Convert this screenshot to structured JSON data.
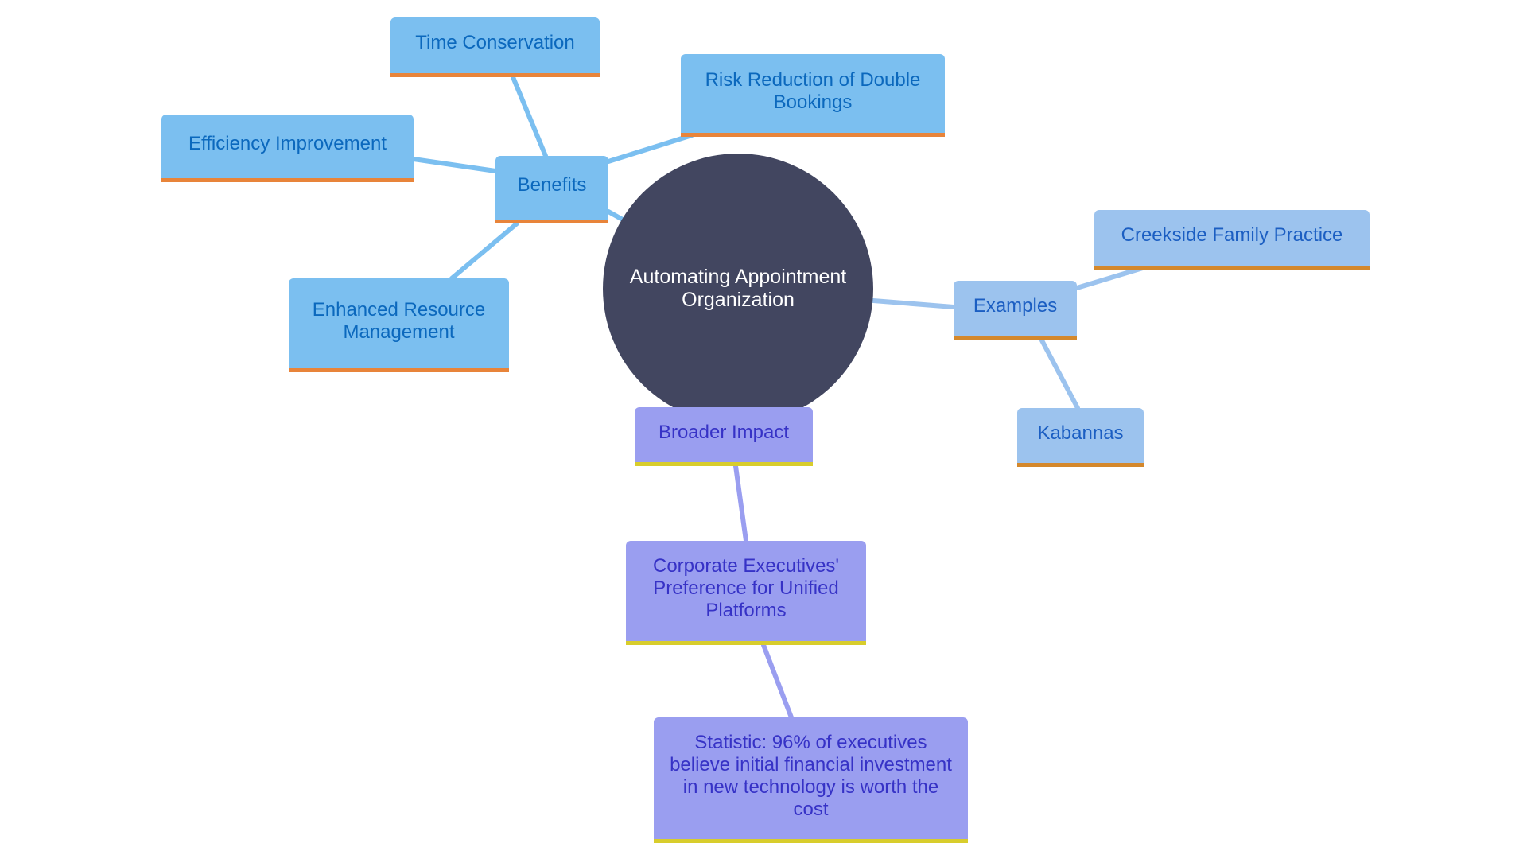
{
  "diagram": {
    "type": "mind-map",
    "center": {
      "label": "Automating Appointment Organization"
    },
    "branches": [
      {
        "label": "Benefits",
        "children": [
          {
            "label": "Time Conservation"
          },
          {
            "label": "Risk Reduction of Double Bookings"
          },
          {
            "label": "Efficiency Improvement"
          },
          {
            "label": "Enhanced Resource Management"
          }
        ]
      },
      {
        "label": "Examples",
        "children": [
          {
            "label": "Creekside Family Practice"
          },
          {
            "label": "Kabannas"
          }
        ]
      },
      {
        "label": "Broader Impact",
        "children": [
          {
            "label": "Corporate Executives' Preference for Unified Platforms",
            "children": [
              {
                "label": "Statistic: 96% of executives believe initial financial investment in new technology is worth the cost"
              }
            ]
          }
        ]
      }
    ],
    "colors": {
      "center_fill": "#424660",
      "benefits_fill": "#7bbff0",
      "examples_fill": "#9cc3ee",
      "impact_fill": "#9a9ef0",
      "benefits_accent": "#e8843a",
      "examples_accent": "#d4882c",
      "impact_accent": "#d8cd2c"
    }
  }
}
